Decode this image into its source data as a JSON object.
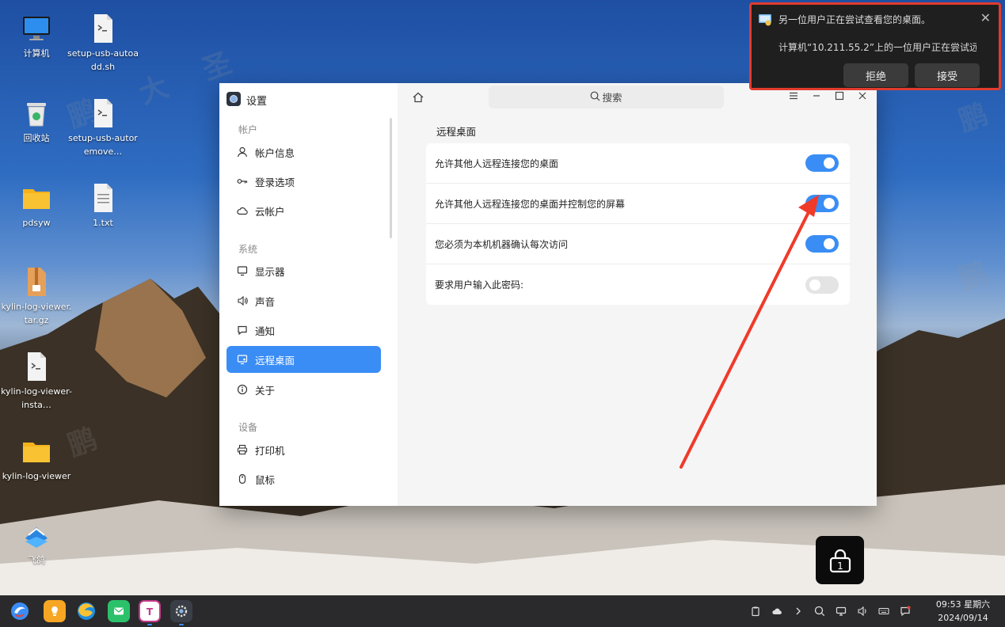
{
  "desktop": {
    "icons": [
      {
        "label": "计算机"
      },
      {
        "label": "setup-usb-autoadd.sh"
      },
      {
        "label": "回收站"
      },
      {
        "label": "setup-usb-autoremove…"
      },
      {
        "label": "pdsyw"
      },
      {
        "label": "1.txt"
      },
      {
        "label": "kylin-log-viewer.tar.gz"
      },
      {
        "label": "kylin-log-viewer-insta…"
      },
      {
        "label": "kylin-log-viewer"
      },
      {
        "label": "飞鸽"
      }
    ]
  },
  "watermark": {
    "chars": [
      "鹏",
      "大",
      "圣"
    ]
  },
  "settings": {
    "title": "设置",
    "search_placeholder": "搜索",
    "groups": [
      {
        "label": "帐户"
      },
      {
        "label": "系统"
      },
      {
        "label": "设备"
      }
    ],
    "nav": [
      {
        "label": "帐户信息",
        "icon": "user-icon"
      },
      {
        "label": "登录选项",
        "icon": "key-icon"
      },
      {
        "label": "云帐户",
        "icon": "cloud-icon"
      },
      {
        "label": "显示器",
        "icon": "monitor-icon"
      },
      {
        "label": "声音",
        "icon": "speaker-icon"
      },
      {
        "label": "通知",
        "icon": "chat-icon"
      },
      {
        "label": "远程桌面",
        "icon": "remote-desktop-icon",
        "active": true
      },
      {
        "label": "关于",
        "icon": "info-icon"
      },
      {
        "label": "打印机",
        "icon": "printer-icon"
      },
      {
        "label": "鼠标",
        "icon": "mouse-icon"
      }
    ],
    "section_title": "远程桌面",
    "rows": [
      {
        "label": "允许其他人远程连接您的桌面",
        "enabled": true
      },
      {
        "label": "允许其他人远程连接您的桌面并控制您的屏幕",
        "enabled": true
      },
      {
        "label": "您必须为本机机器确认每次访问",
        "enabled": true
      },
      {
        "label": "要求用户输入此密码:",
        "enabled": false
      }
    ]
  },
  "notification": {
    "title": "另一位用户正在尝试查看您的桌面。",
    "body": "计算机“10.211.55.2”上的一位用户正在尝试远…",
    "reject_label": "拒绝",
    "accept_label": "接受"
  },
  "lock": {
    "count": "1"
  },
  "taskbar": {
    "time": "09:53 星期六",
    "date": "2024/09/14"
  },
  "colors": {
    "accent": "#3a8df5",
    "highlight_border": "#e23b2e",
    "arrow": "#f03a2a"
  }
}
